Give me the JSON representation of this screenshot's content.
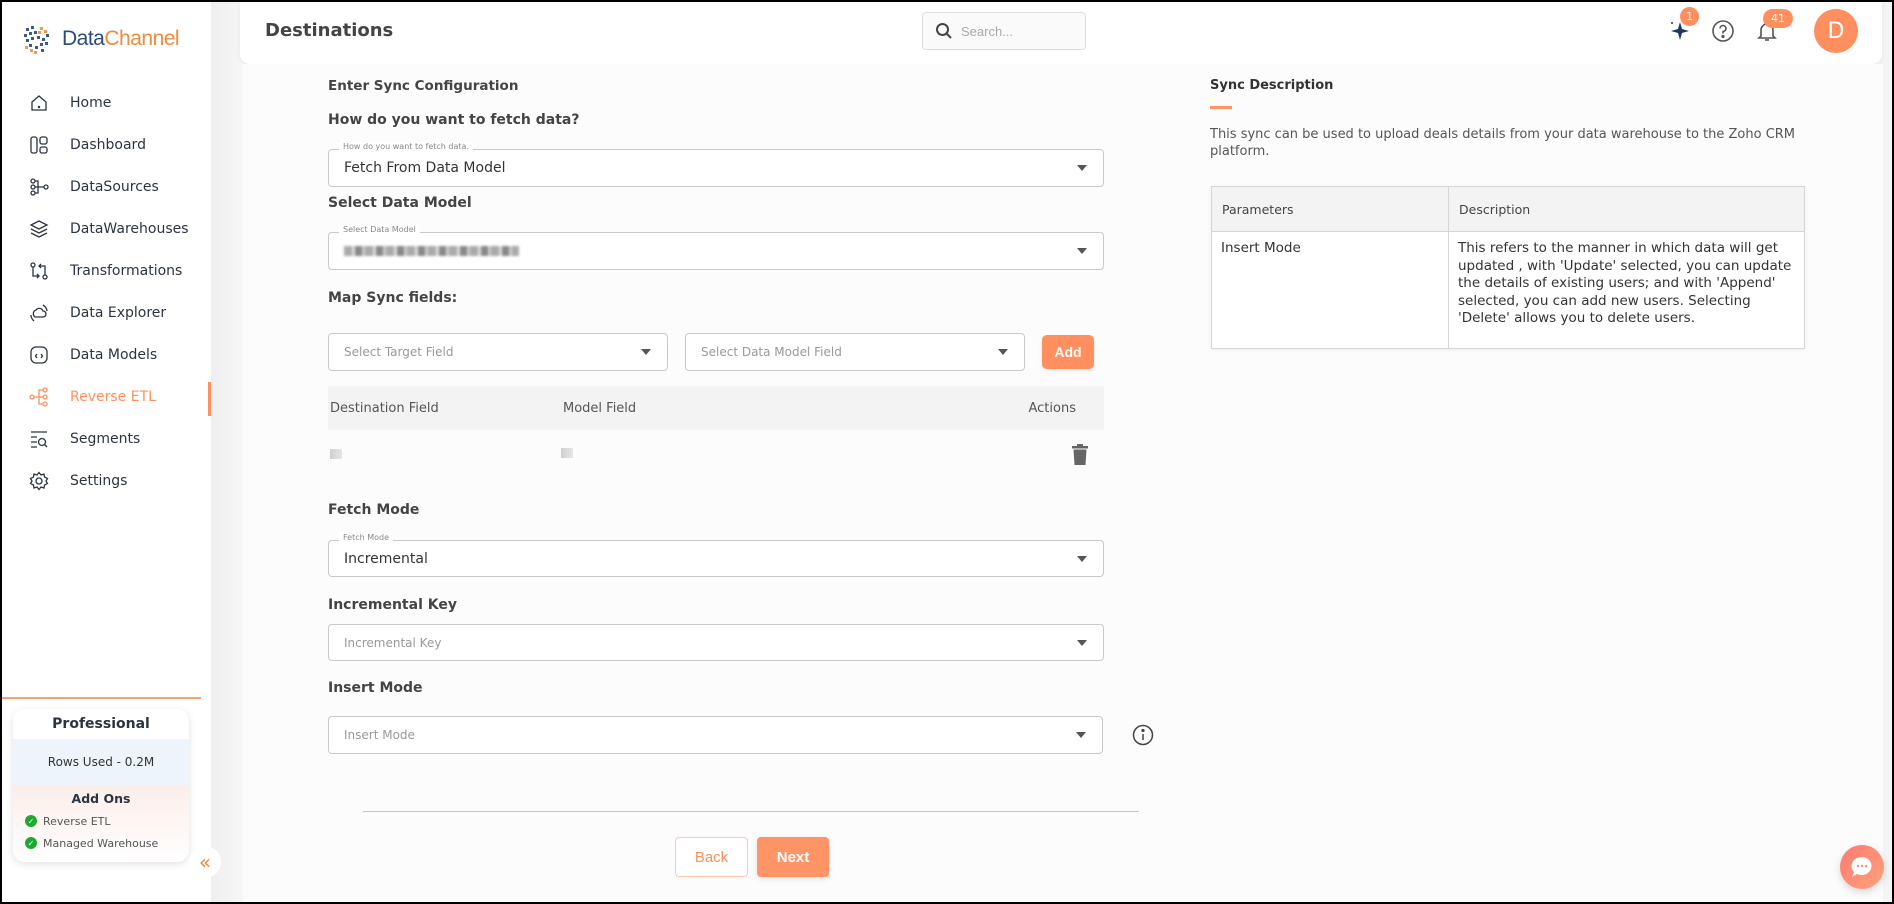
{
  "brand": {
    "name_part1": "Data",
    "name_part2": "Channel",
    "accent": "#ff8f5e",
    "navy": "#2e4a7a"
  },
  "header": {
    "title": "Destinations",
    "search_placeholder": "Search...",
    "sparkle_badge": "1",
    "notifications_badge": "41",
    "avatar_initial": "D"
  },
  "sidebar": {
    "items": [
      {
        "label": "Home",
        "icon": "home-icon"
      },
      {
        "label": "Dashboard",
        "icon": "dashboard-icon"
      },
      {
        "label": "DataSources",
        "icon": "datasources-icon"
      },
      {
        "label": "DataWarehouses",
        "icon": "layers-icon"
      },
      {
        "label": "Transformations",
        "icon": "transform-icon"
      },
      {
        "label": "Data Explorer",
        "icon": "explorer-icon"
      },
      {
        "label": "Data Models",
        "icon": "code-box-icon"
      },
      {
        "label": "Reverse ETL",
        "icon": "reverse-etl-icon",
        "active": true
      },
      {
        "label": "Segments",
        "icon": "segments-icon"
      },
      {
        "label": "Settings",
        "icon": "gear-icon"
      }
    ],
    "plan": {
      "title": "Professional",
      "rows_used": "Rows Used - 0.2M",
      "addons_title": "Add Ons",
      "addons": [
        "Reverse ETL",
        "Managed Warehouse"
      ]
    }
  },
  "form": {
    "section_title": "Enter Sync Configuration",
    "fetch": {
      "label": "How do you want to fetch data?",
      "legend": "How do you want to fetch data.",
      "value": "Fetch From Data Model"
    },
    "data_model": {
      "label": "Select Data Model",
      "legend": "Select Data Model",
      "value_redacted": true
    },
    "map": {
      "label": "Map Sync fields:",
      "target_placeholder": "Select Target Field",
      "model_placeholder": "Select Data Model Field",
      "add_label": "Add",
      "columns": [
        "Destination Field",
        "Model Field",
        "Actions"
      ],
      "rows": [
        {
          "destination_field": "",
          "model_field": "",
          "redacted": true
        }
      ]
    },
    "fetch_mode": {
      "label": "Fetch Mode",
      "legend": "Fetch Mode",
      "value": "Incremental"
    },
    "incremental_key": {
      "label": "Incremental Key",
      "placeholder": "Incremental Key"
    },
    "insert_mode": {
      "label": "Insert Mode",
      "placeholder": "Insert Mode"
    },
    "back_label": "Back",
    "next_label": "Next"
  },
  "sync_description": {
    "title": "Sync Description",
    "text": "This sync can be used to upload deals details from your data warehouse to the Zoho CRM platform.",
    "table": {
      "headers": [
        "Parameters",
        "Description"
      ],
      "rows": [
        {
          "parameter": "Insert Mode",
          "description": "This refers to the manner in which data will get updated , with 'Update' selected, you can update the details of existing users; and with 'Append' selected, you can add new users. Selecting 'Delete' allows you to delete users."
        }
      ]
    }
  }
}
